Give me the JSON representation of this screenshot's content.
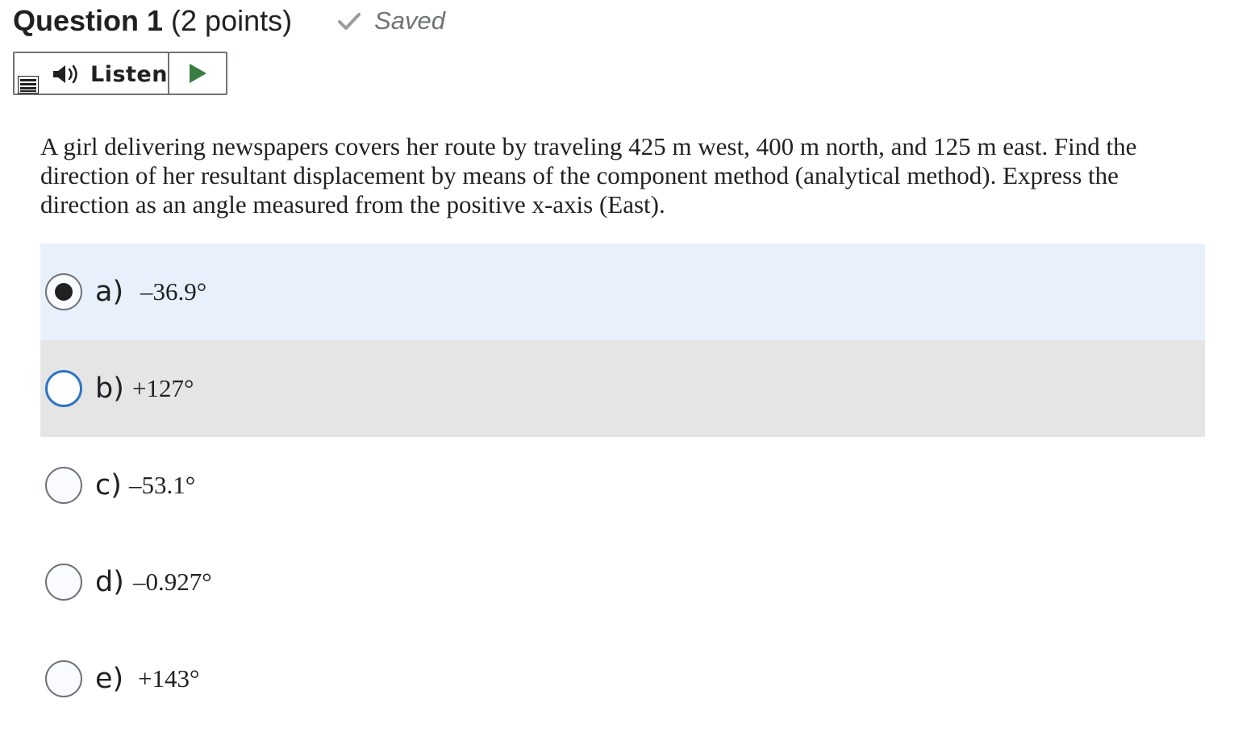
{
  "question": {
    "number_label": "Question 1",
    "points_label": "(2 points)",
    "status": "Saved",
    "text": "A girl delivering newspapers covers her route by traveling 425 m west, 400 m north, and 125 m east. Find the direction of her resultant displacement by means of the component method (analytical method). Express the direction as an angle measured from the positive x-axis (East)."
  },
  "listen": {
    "label": "Listen",
    "icons": [
      "menu-icon",
      "speaker-icon",
      "play-icon"
    ],
    "play_color": "#3a7d44"
  },
  "options": [
    {
      "letter": "a)",
      "value": "–36.9°",
      "selected": true
    },
    {
      "letter": "b)",
      "value": "+127°",
      "selected": false,
      "focused": true
    },
    {
      "letter": "c)",
      "value": "–53.1°",
      "selected": false
    },
    {
      "letter": "d)",
      "value": "–0.927°",
      "selected": false
    },
    {
      "letter": "e)",
      "value": "+143°",
      "selected": false
    }
  ],
  "colors": {
    "selected_bg": "#e8f1fb",
    "hover_bg": "#e5e5e5",
    "focus_ring": "#2e74c4"
  }
}
